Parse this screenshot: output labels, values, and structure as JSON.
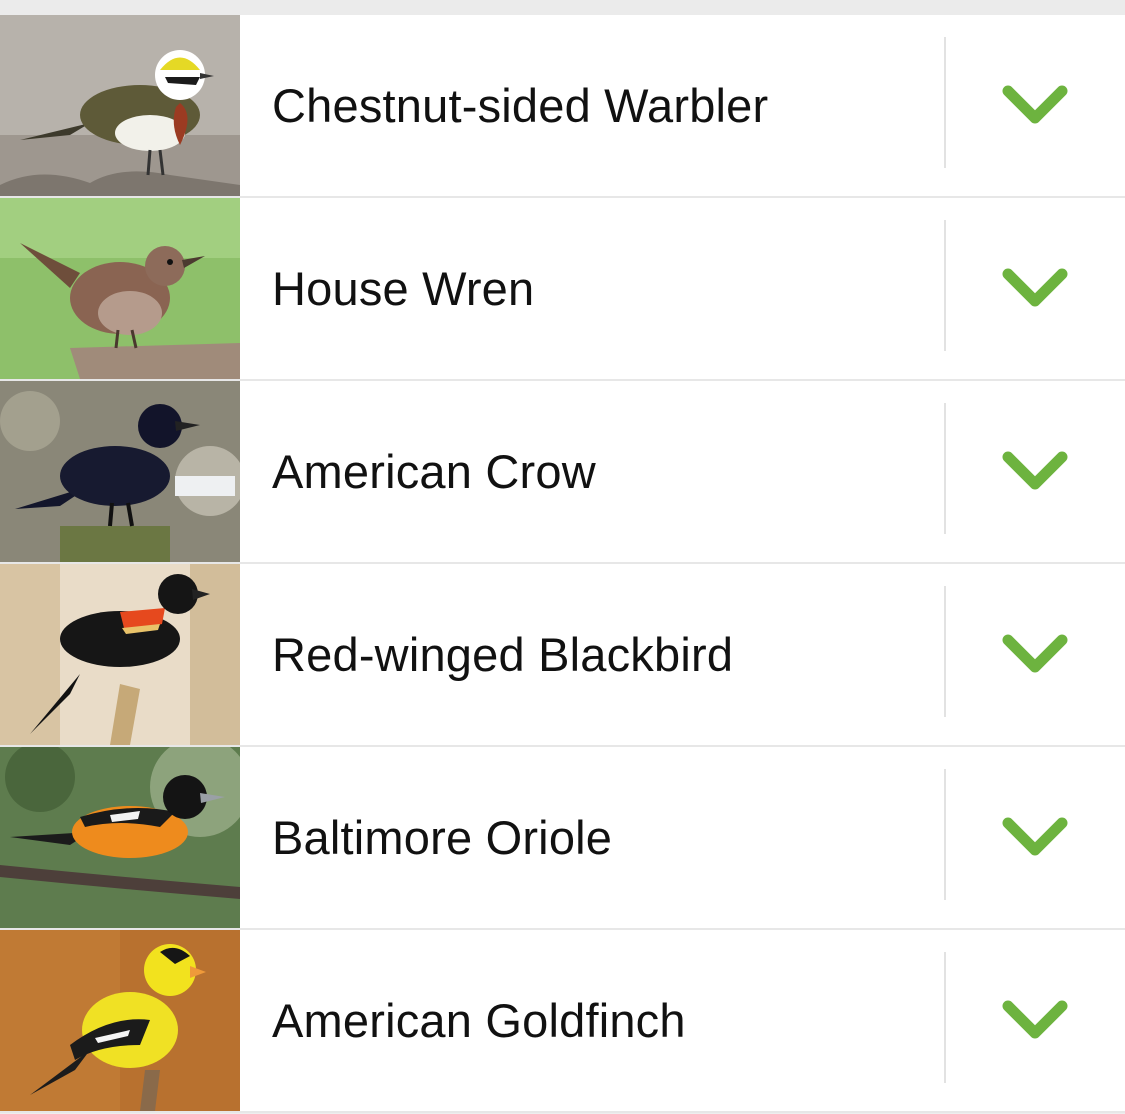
{
  "accent_color": "#6db33f",
  "species": [
    {
      "name": "Chestnut-sided Warbler",
      "image": "chestnut-sided-warbler-photo",
      "expand_icon": "chevron-down-icon"
    },
    {
      "name": "House Wren",
      "image": "house-wren-photo",
      "expand_icon": "chevron-down-icon"
    },
    {
      "name": "American Crow",
      "image": "american-crow-photo",
      "expand_icon": "chevron-down-icon"
    },
    {
      "name": "Red-winged Blackbird",
      "image": "red-winged-blackbird-photo",
      "expand_icon": "chevron-down-icon"
    },
    {
      "name": "Baltimore Oriole",
      "image": "baltimore-oriole-photo",
      "expand_icon": "chevron-down-icon"
    },
    {
      "name": "American Goldfinch",
      "image": "american-goldfinch-photo",
      "expand_icon": "chevron-down-icon"
    }
  ]
}
